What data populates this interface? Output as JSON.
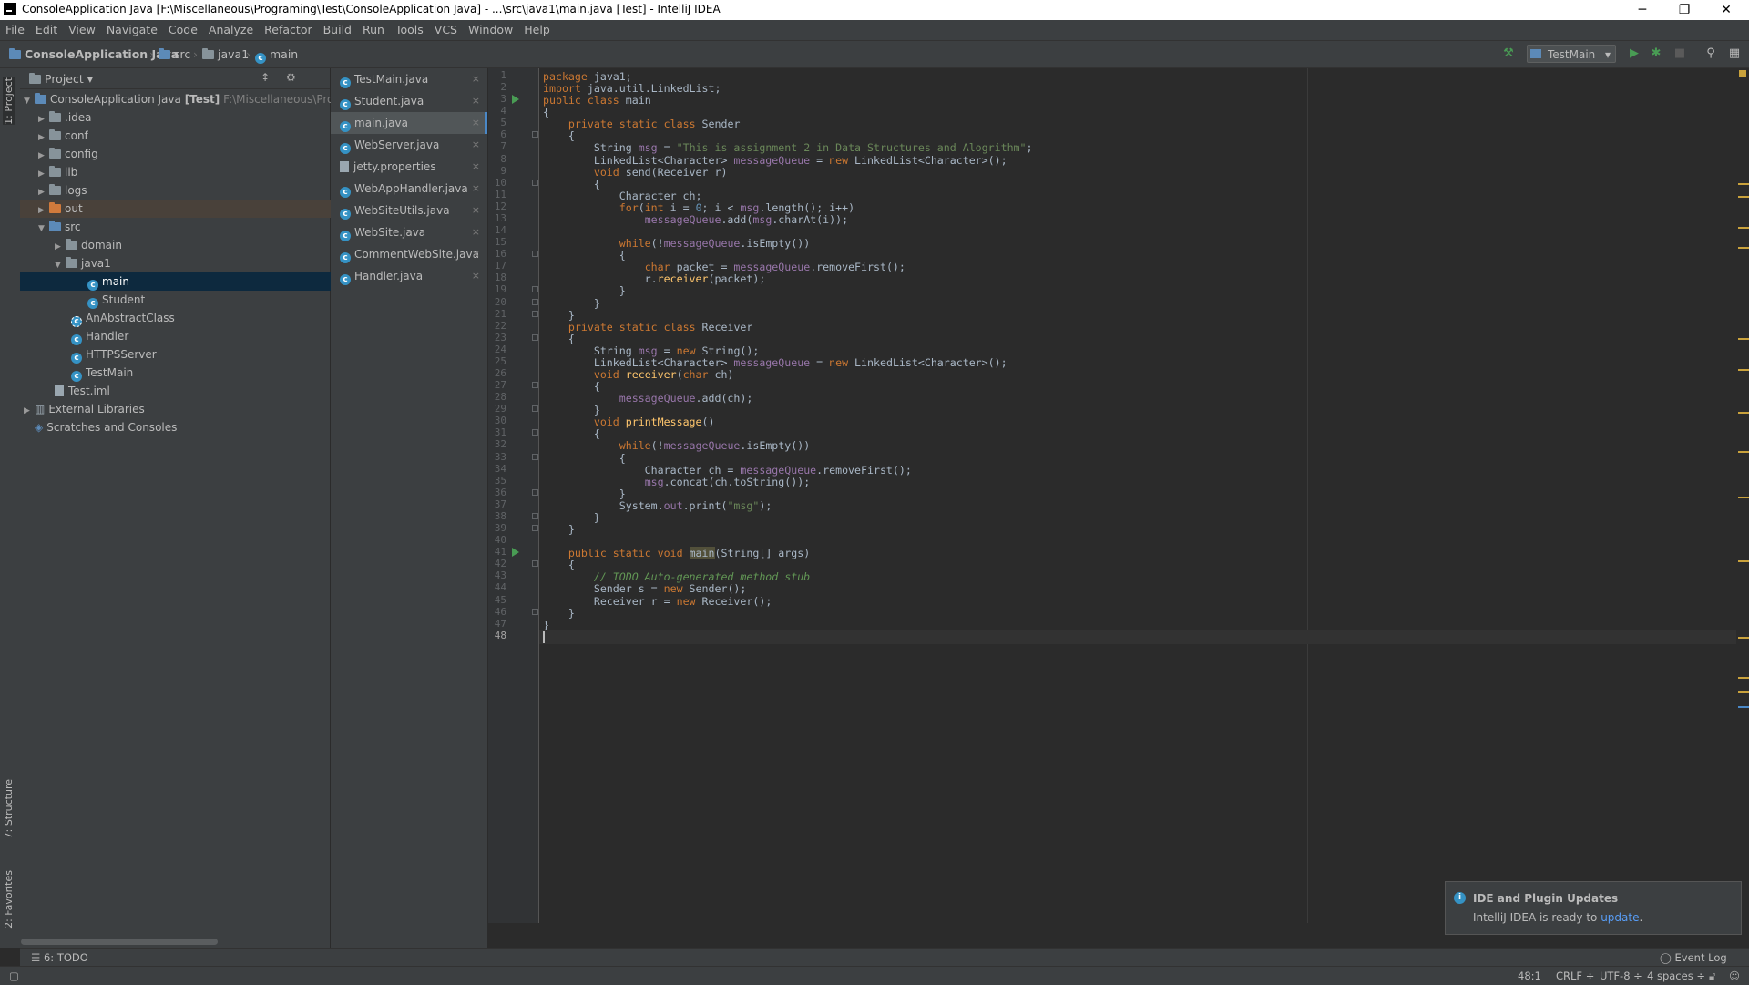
{
  "window": {
    "title": "ConsoleApplication Java [F:\\Miscellaneous\\Programing\\Test\\ConsoleApplication Java] - ...\\src\\java1\\main.java [Test] - IntelliJ IDEA",
    "minimize": "─",
    "restore": "❐",
    "close": "✕"
  },
  "menu": [
    "File",
    "Edit",
    "View",
    "Navigate",
    "Code",
    "Analyze",
    "Refactor",
    "Build",
    "Run",
    "Tools",
    "VCS",
    "Window",
    "Help"
  ],
  "breadcrumb": {
    "project": "ConsoleApplication Java",
    "src": "src",
    "package": "java1",
    "file": "main"
  },
  "toolbar": {
    "run_config": "TestMain"
  },
  "left_strip": {
    "project_tab": "1: Project",
    "structure_tab": "7: Structure",
    "favorites_tab": "2: Favorites"
  },
  "project_panel": {
    "header": "Project",
    "root_name": "ConsoleApplication Java",
    "root_module": "[Test]",
    "root_path": "F:\\Miscellaneous\\Programing\\Test\\ConsoleApplication Java",
    "items": [
      ".idea",
      "conf",
      "config",
      "lib",
      "logs",
      "out",
      "src",
      "domain",
      "java1",
      "main",
      "Student",
      "AnAbstractClass",
      "Handler",
      "HTTPSServer",
      "TestMain",
      "Test.iml",
      "External Libraries",
      "Scratches and Consoles"
    ]
  },
  "tabs": [
    "TestMain.java",
    "Student.java",
    "main.java",
    "WebServer.java",
    "jetty.properties",
    "WebAppHandler.java",
    "WebSiteUtils.java",
    "WebSite.java",
    "CommentWebSite.java",
    "Handler.java"
  ],
  "tab_close": "×",
  "active_tab": "main.java",
  "code": {
    "current_line": 48,
    "lines": [
      "package java1;",
      "import java.util.LinkedList;",
      "public class main",
      "{",
      "    private static class Sender",
      "    {",
      "        String msg = \"This is assignment 2 in Data Structures and Alogrithm\";",
      "        LinkedList<Character> messageQueue = new LinkedList<Character>();",
      "        void send(Receiver r)",
      "        {",
      "            Character ch;",
      "            for(int i = 0; i < msg.length(); i++)",
      "                messageQueue.add(msg.charAt(i));",
      "",
      "            while(!messageQueue.isEmpty())",
      "            {",
      "                char packet = messageQueue.removeFirst();",
      "                r.receiver(packet);",
      "            }",
      "        }",
      "    }",
      "    private static class Receiver",
      "    {",
      "        String msg = new String();",
      "        LinkedList<Character> messageQueue = new LinkedList<Character>();",
      "        void receiver(char ch)",
      "        {",
      "            messageQueue.add(ch);",
      "        }",
      "        void printMessage()",
      "        {",
      "            while(!messageQueue.isEmpty())",
      "            {",
      "                Character ch = messageQueue.removeFirst();",
      "                msg.concat(ch.toString());",
      "            }",
      "            System.out.print(\"msg\");",
      "        }",
      "    }",
      "",
      "    public static void main(String[] args)",
      "    {",
      "        // TODO Auto-generated method stub",
      "        Sender s = new Sender();",
      "        Receiver r = new Receiver();",
      "    }",
      "}",
      ""
    ]
  },
  "notification": {
    "title": "IDE and Plugin Updates",
    "body": "IntelliJ IDEA is ready to ",
    "link": "update",
    "tail": ".",
    "info_glyph": "i"
  },
  "bottom": {
    "todo": "6: TODO",
    "event_log": "Event Log"
  },
  "status": {
    "position": "48:1",
    "line_sep": "CRLF ÷",
    "encoding": "UTF-8 ÷",
    "indent": "4 spaces ÷"
  },
  "colors": {
    "accent": "#4a88c7",
    "run_green": "#499c54",
    "keyword": "#cc7832",
    "string": "#6a8759",
    "field": "#9876aa",
    "method": "#ffc66d",
    "number": "#6897bb"
  }
}
